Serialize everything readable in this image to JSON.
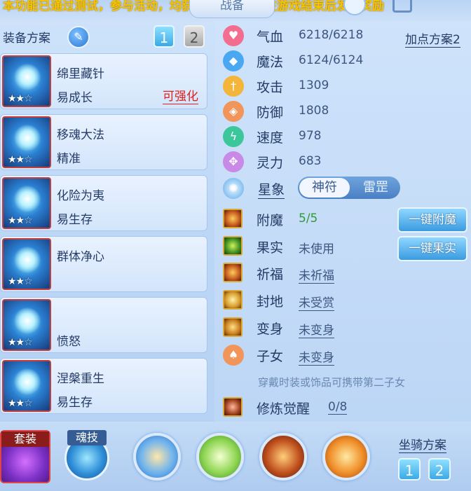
{
  "header": {
    "ticker_text": "本功能已通过测试，参与活动，均获赠精彩新，将在游戏结束后发放奖励",
    "window_title": "战备"
  },
  "left": {
    "title": "装备方案",
    "set_buttons": [
      "1",
      "2"
    ],
    "cards": [
      {
        "name": "绵里藏针",
        "trait": "易成长",
        "enhance": "可强化",
        "stars": "★★☆"
      },
      {
        "name": "移魂大法",
        "trait": "精准",
        "enhance": "",
        "stars": "★★☆"
      },
      {
        "name": "化险为夷",
        "trait": "易生存",
        "enhance": "",
        "stars": "★★☆"
      },
      {
        "name": "群体净心",
        "trait": "",
        "enhance": "",
        "stars": "★★☆"
      },
      {
        "name": "",
        "trait": "愤怒",
        "enhance": "",
        "stars": "★★☆"
      },
      {
        "name": "涅槃重生",
        "trait": "易生存",
        "enhance": "",
        "stars": "★★☆"
      }
    ]
  },
  "stats": {
    "plan_link": "加点方案2",
    "rows": [
      {
        "label": "气血",
        "value": "6218/6218",
        "icon": "heart-icon",
        "color": "#f26d8f"
      },
      {
        "label": "魔法",
        "value": "6124/6124",
        "icon": "droplet-icon",
        "color": "#4aa8f2"
      },
      {
        "label": "攻击",
        "value": "1309",
        "icon": "sword-icon",
        "color": "#f4b63a"
      },
      {
        "label": "防御",
        "value": "1808",
        "icon": "shield-icon",
        "color": "#f2955a"
      },
      {
        "label": "速度",
        "value": "978",
        "icon": "lightning-icon",
        "color": "#3cc79a"
      },
      {
        "label": "灵力",
        "value": "683",
        "icon": "spirit-icon",
        "color": "#c88ae6"
      }
    ],
    "star_label": "星象",
    "star_options": [
      "神符",
      "雷罡"
    ]
  },
  "extras": {
    "rows": [
      {
        "label": "附魔",
        "value": "5/5"
      },
      {
        "label": "果实",
        "value": "未使用"
      },
      {
        "label": "祈福",
        "value": "未祈福"
      },
      {
        "label": "封地",
        "value": "未受赏"
      },
      {
        "label": "变身",
        "value": "未变身"
      },
      {
        "label": "子女",
        "value": "未变身"
      }
    ],
    "btn_enchant": "一键附魔",
    "btn_fruit": "一键果实",
    "hint": "穿戴时装或饰品可携带第二子女",
    "awaken_label": "修炼觉醒",
    "awaken_value": "0/8"
  },
  "bottom": {
    "outfit_label": "套装",
    "soul_label": "魂技",
    "mount_plan_label": "坐骑方案",
    "mount_sets": [
      "1",
      "2"
    ]
  }
}
